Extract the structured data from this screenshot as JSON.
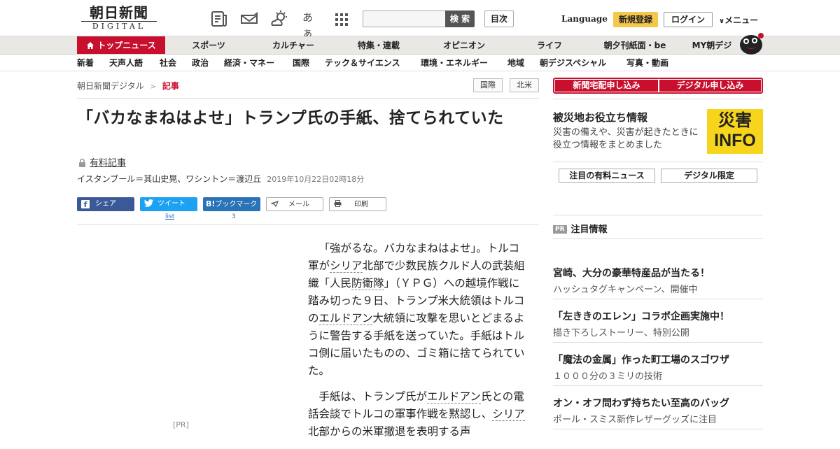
{
  "header": {
    "logo_main": "朝日新聞",
    "logo_sub": "DIGITAL",
    "kana_icon_label": "あぁ",
    "search_placeholder": "",
    "search_button": "検 索",
    "toc_button": "目次",
    "language": "Language",
    "signup": "新規登録",
    "login": "ログイン",
    "menu": "メニュー"
  },
  "nav_primary": [
    "トップニュース",
    "スポーツ",
    "カルチャー",
    "特集・連載",
    "オピニオン",
    "ライフ",
    "朝夕刊紙面・be",
    "MY朝デジ"
  ],
  "nav_secondary": [
    "新着",
    "天声人語",
    "社会",
    "政治",
    "経済・マネー",
    "国際",
    "テック＆サイエンス",
    "環境・エネルギー",
    "地域",
    "朝デジスペシャル",
    "写真・動画"
  ],
  "breadcrumb": {
    "home": "朝日新聞デジタル",
    "sep": ">",
    "current": "記事"
  },
  "tags": [
    "国際",
    "北米"
  ],
  "article": {
    "title": "「バカなまねはよせ」トランプ氏の手紙、捨てられていた",
    "paid_label": "有料記事",
    "byline": "イスタンブール＝其山史晃、ワシントン＝渡辺丘",
    "date": "2019年10月22日02時18分",
    "pr_label": "[PR]",
    "share": {
      "facebook": "シェア",
      "twitter": "ツイート",
      "twitter_count": "list",
      "bookmark": "ブックマーク",
      "bookmark_count": "3",
      "mail": "メール",
      "print": "印刷"
    },
    "p1": [
      {
        "t": "「強がるな。バカなまねはよせ」。トルコ軍が"
      },
      {
        "t": "シリア",
        "kw": true
      },
      {
        "t": "北部で少数民族クルド人の武装組織「人民"
      },
      {
        "t": "防衛隊",
        "kw": true
      },
      {
        "t": "」（ＹＰＧ）への越境作戦に踏み切った９日、トランプ米大統領はトルコの"
      },
      {
        "t": "エルドアン",
        "kw": true
      },
      {
        "t": "大統領に攻撃を思いとどまるように警告する手紙を送っていた。手紙はトルコ側に届いたものの、ゴミ箱に捨てられていた。"
      }
    ],
    "p2": [
      {
        "t": "手紙は、トランプ氏が"
      },
      {
        "t": "エルドアン",
        "kw": true
      },
      {
        "t": "氏との電話会談でトルコの軍事作戦を黙認し、"
      },
      {
        "t": "シリア",
        "kw": true
      },
      {
        "t": "北部からの米軍撤退を表明する声"
      }
    ]
  },
  "sidebar": {
    "btn_newspaper": "新聞宅配申し込み",
    "btn_digital": "デジタル申し込み",
    "disaster_title": "被災地お役立ち情報",
    "disaster_text": "災害の備えや、災害が起きたときに役立つ情報をまとめました",
    "disaster_img_top": "災害",
    "disaster_img_bottom": "INFO",
    "btn_paid_news": "注目の有料ニュース",
    "btn_digital_only": "デジタル限定",
    "pr_badge": "PR",
    "pr_heading": "注目情報",
    "pr_items": [
      {
        "title": "宮崎、大分の豪華特産品が当たる！",
        "sub": "ハッシュタグキャンペーン、開催中"
      },
      {
        "title": "「左ききのエレン」コラボ企画実施中！",
        "sub": "描き下ろしストーリー、特別公開"
      },
      {
        "title": "「魔法の金属」作った町工場のスゴワザ",
        "sub": "１０００分の３ミリの技術"
      },
      {
        "title": "オン・オフ問わず持ちたい至高のバッグ",
        "sub": "ポール・スミス新作レザーグッズに注目"
      }
    ]
  },
  "colors": {
    "accent": "#c8102e",
    "signup": "#f5c84c",
    "facebook": "#3b5998",
    "twitter": "#1da1f2",
    "hatena": "#2a73b8"
  }
}
